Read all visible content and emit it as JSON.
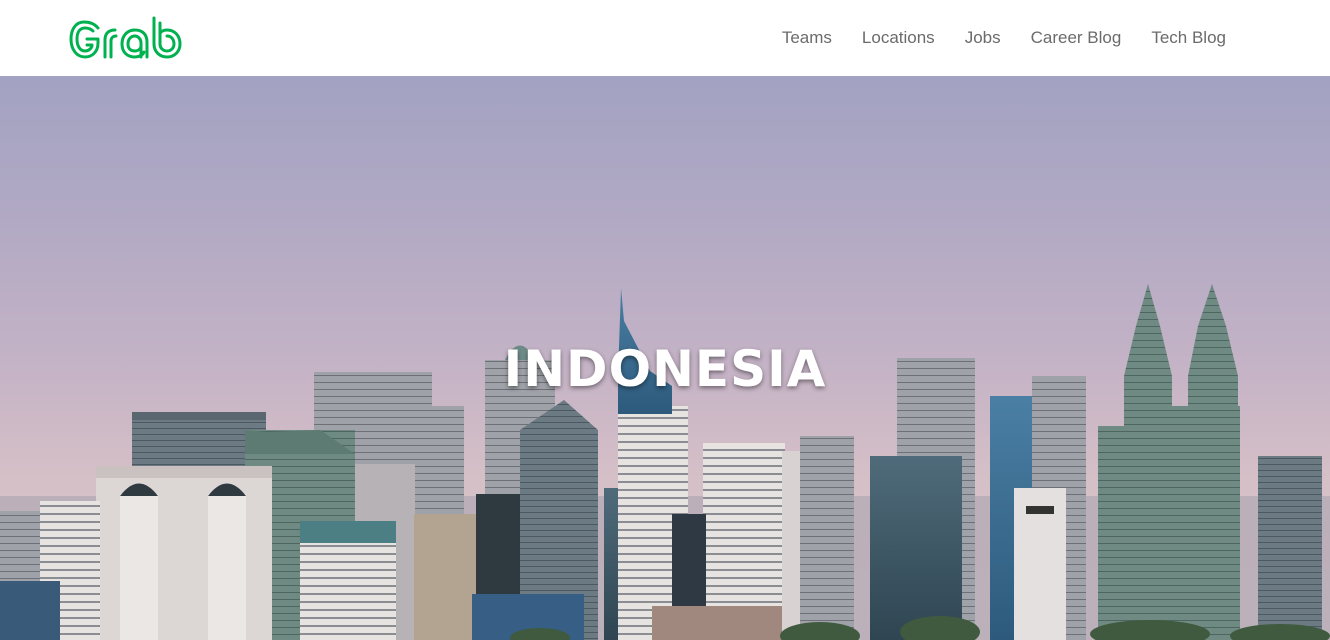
{
  "brand": {
    "logo_text": "Grab",
    "logo_color": "#00b14f"
  },
  "nav": {
    "items": [
      {
        "label": "Teams"
      },
      {
        "label": "Locations"
      },
      {
        "label": "Jobs"
      },
      {
        "label": "Career Blog"
      },
      {
        "label": "Tech Blog"
      }
    ]
  },
  "hero": {
    "title": "INDONESIA",
    "image": "jakarta-skyline"
  }
}
